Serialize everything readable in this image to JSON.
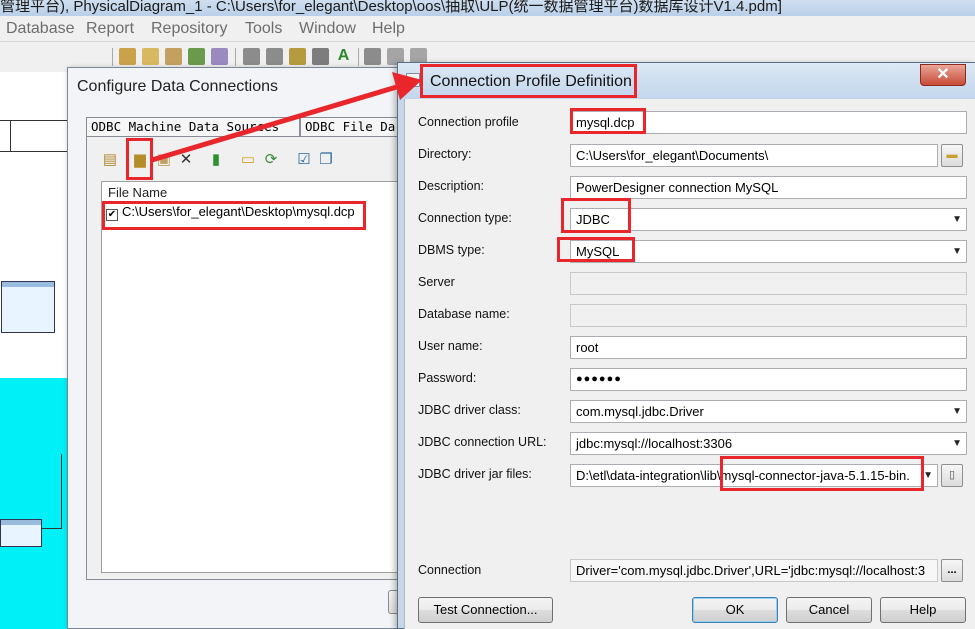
{
  "app": {
    "title": "管理平台), PhysicalDiagram_1 - C:\\Users\\for_elegant\\Desktop\\oos\\抽取\\ULP(统一数据管理平台)数据库设计V1.4.pdm]",
    "menu": [
      "Database",
      "Report",
      "Repository",
      "Tools",
      "Window",
      "Help"
    ]
  },
  "config_dialog": {
    "title": "Configure Data Connections",
    "tabs": [
      "ODBC Machine Data Sources",
      "ODBC File Da"
    ],
    "toolbar_icons": [
      "properties-icon",
      "add-data-source-icon",
      "new-data-source-icon",
      "delete-icon",
      "connect-icon",
      "open-folder-icon",
      "refresh-icon",
      "select-icon",
      "deselect-icon"
    ],
    "list_header": "File Name",
    "rows": [
      {
        "checked": true,
        "path": "C:\\Users\\for_elegant\\Desktop\\mysql.dcp"
      }
    ]
  },
  "profile_dialog": {
    "title": "Connection Profile Definition",
    "close_label": "✕",
    "fields": {
      "connection_profile": {
        "label": "Connection profile",
        "value": "mysql.dcp"
      },
      "directory": {
        "label": "Directory:",
        "value": "C:\\Users\\for_elegant\\Documents\\"
      },
      "description": {
        "label": "Description:",
        "value": "PowerDesigner connection MySQL"
      },
      "connection_type": {
        "label": "Connection type:",
        "value": "JDBC"
      },
      "dbms_type": {
        "label": "DBMS type:",
        "value": "MySQL"
      },
      "server": {
        "label": "Server",
        "value": ""
      },
      "database_name": {
        "label": "Database name:",
        "value": ""
      },
      "user_name": {
        "label": "User name:",
        "value": "root"
      },
      "password": {
        "label": "Password:",
        "value": "●●●●●●"
      },
      "jdbc_driver_class": {
        "label": "JDBC driver class:",
        "value": "com.mysql.jdbc.Driver"
      },
      "jdbc_url": {
        "label": "JDBC connection URL:",
        "value": "jdbc:mysql://localhost:3306"
      },
      "jdbc_jar": {
        "label": "JDBC driver jar files:",
        "value_prefix": "D:\\etl\\data-integration\\lib\\",
        "value_highlight": "mysql-connector-java-5.1.15-bin."
      },
      "connection": {
        "label": "Connection",
        "value": "Driver='com.mysql.jdbc.Driver',URL='jdbc:mysql://localhost:3"
      }
    },
    "buttons": {
      "test": "Test Connection...",
      "ok": "OK",
      "cancel": "Cancel",
      "help": "Help"
    }
  },
  "colors": {
    "annotation": "#e8262b",
    "cyan_area": "#00f0f8",
    "title_bar": "#c3d6ec"
  }
}
